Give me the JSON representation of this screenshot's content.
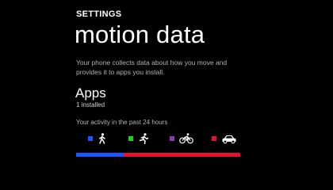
{
  "header": {
    "section": "SETTINGS",
    "title": "motion data"
  },
  "description": "Your phone collects data about how you move and provides it to apps you install.",
  "apps": {
    "title": "Apps",
    "status": "1 installed"
  },
  "activity": {
    "label": "Your activity in the past 24 hours",
    "categories": [
      {
        "name": "walking",
        "icon": "walking-icon",
        "color": "#1a56ff"
      },
      {
        "name": "running",
        "icon": "running-icon",
        "color": "#22cc22"
      },
      {
        "name": "cycling",
        "icon": "bicycle-icon",
        "color": "#8b3ab3"
      },
      {
        "name": "driving",
        "icon": "car-icon",
        "color": "#e8112d"
      }
    ],
    "bar_shares": [
      0.29,
      0,
      0,
      0.71
    ]
  }
}
